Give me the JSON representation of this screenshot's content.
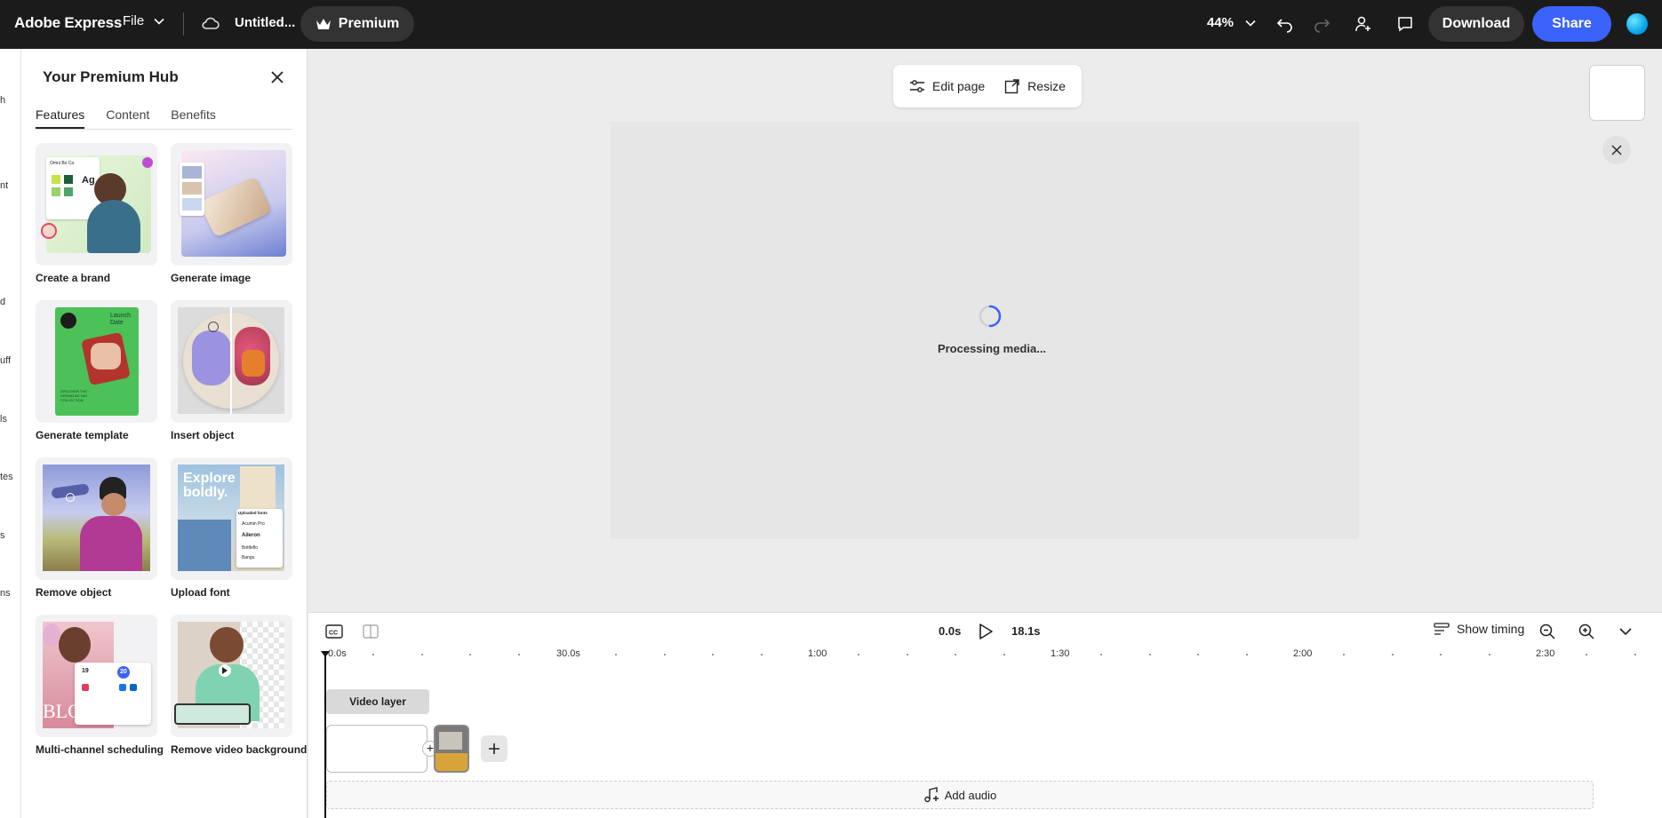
{
  "topbar": {
    "brand": "Adobe Express",
    "file_label": "File",
    "doc_title": "Untitled...",
    "premium_label": "Premium",
    "zoom": "44%",
    "download_label": "Download",
    "share_label": "Share"
  },
  "rail": [
    "h",
    "nt",
    "d",
    "uff",
    "ls",
    "tes",
    "s",
    "ns"
  ],
  "hub": {
    "title": "Your Premium Hub",
    "tabs": [
      "Features",
      "Content",
      "Benefits"
    ],
    "cards": [
      {
        "label": "Create a brand"
      },
      {
        "label": "Generate image"
      },
      {
        "label": "Generate template"
      },
      {
        "label": "Insert object"
      },
      {
        "label": "Remove object"
      },
      {
        "label": "Upload font"
      },
      {
        "label": "Multi-channel scheduling"
      },
      {
        "label": "Remove video background"
      }
    ],
    "thumb_text": {
      "brand_company": "Omni Bo Co.",
      "brand_font": "Ag",
      "template_launch": "Launch Date",
      "template_collection": "DISCOVER THE VERSATILE SAT COLLECTION",
      "font_headline": "Explore boldly.",
      "font_list_title": "Uploaded fonts",
      "font_list": [
        "Acumin Pro",
        "Aileron",
        "Bottleflo",
        "Bangu"
      ],
      "sched_a": "19",
      "sched_b": "20",
      "sched_word": "BLO"
    }
  },
  "canvas": {
    "edit_page": "Edit page",
    "resize": "Resize",
    "processing": "Processing media..."
  },
  "timeline": {
    "current_time": "0.0s",
    "total_time": "18.1s",
    "show_timing": "Show timing",
    "ruler": [
      "0.0s",
      "30.0s",
      "1:00",
      "1:30",
      "2:00",
      "2:30"
    ],
    "video_layer": "Video layer",
    "add_audio": "Add audio"
  },
  "colors": {
    "topbar": "#1b1b1b",
    "share": "#3b63fb",
    "canvas_bg": "#ececec"
  }
}
